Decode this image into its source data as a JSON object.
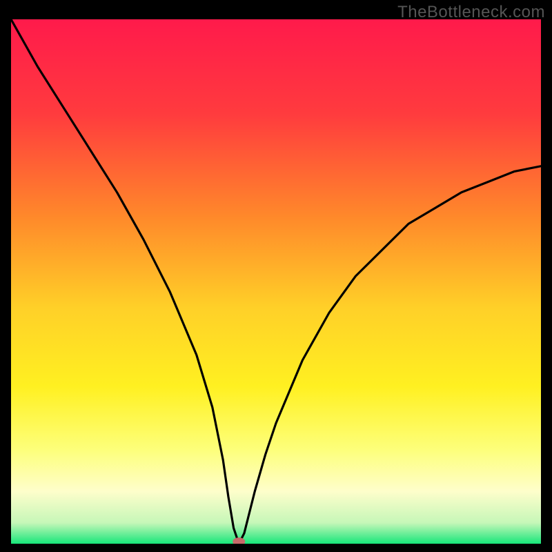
{
  "watermark": "TheBottleneck.com",
  "chart_data": {
    "type": "line",
    "title": "",
    "xlabel": "",
    "ylabel": "",
    "xlim": [
      0,
      100
    ],
    "ylim": [
      0,
      100
    ],
    "x": [
      0,
      5,
      10,
      15,
      20,
      25,
      30,
      35,
      38,
      40,
      41,
      42,
      43,
      44,
      45,
      46,
      48,
      50,
      55,
      60,
      65,
      70,
      75,
      80,
      85,
      90,
      95,
      100
    ],
    "values": [
      100,
      91,
      83,
      75,
      67,
      58,
      48,
      36,
      26,
      16,
      9,
      3,
      0,
      2,
      6,
      10,
      17,
      23,
      35,
      44,
      51,
      56,
      61,
      64,
      67,
      69,
      71,
      72
    ],
    "marker": {
      "x": 43,
      "y": 0
    },
    "gradient_stops": [
      {
        "offset": 0.0,
        "color": "#ff1a4b"
      },
      {
        "offset": 0.18,
        "color": "#ff3b3e"
      },
      {
        "offset": 0.38,
        "color": "#ff8a2a"
      },
      {
        "offset": 0.55,
        "color": "#ffd028"
      },
      {
        "offset": 0.7,
        "color": "#fff021"
      },
      {
        "offset": 0.82,
        "color": "#fdff7a"
      },
      {
        "offset": 0.9,
        "color": "#fefecb"
      },
      {
        "offset": 0.96,
        "color": "#c6f7b8"
      },
      {
        "offset": 1.0,
        "color": "#17e67a"
      }
    ],
    "colors": {
      "line": "#000000",
      "marker_fill": "#c76a6a",
      "marker_stroke": "#8a3d3d",
      "background": "#000000"
    }
  }
}
